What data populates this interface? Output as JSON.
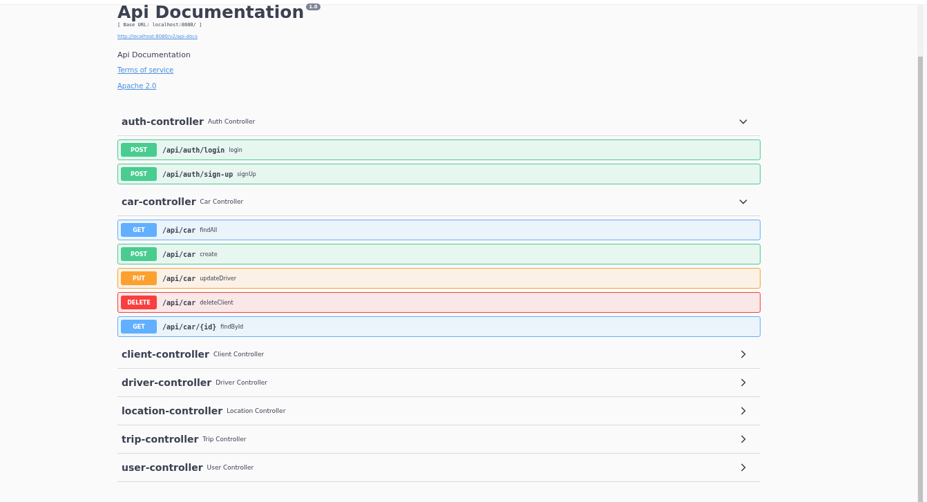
{
  "info": {
    "title": "Api Documentation",
    "version": "1.0",
    "base_url": "[ Base URL: localhost:8080/ ]",
    "docs_link": "http://localhost:8080/v2/api-docs",
    "description": "Api Documentation",
    "terms_link": "Terms of service",
    "license_link": "Apache 2.0"
  },
  "sections": [
    {
      "name": "auth-controller",
      "description": "Auth Controller",
      "expanded": true,
      "operations": [
        {
          "method": "POST",
          "path": "/api/auth/login",
          "summary": "login"
        },
        {
          "method": "POST",
          "path": "/api/auth/sign-up",
          "summary": "signUp"
        }
      ]
    },
    {
      "name": "car-controller",
      "description": "Car Controller",
      "expanded": true,
      "operations": [
        {
          "method": "GET",
          "path": "/api/car",
          "summary": "findAll"
        },
        {
          "method": "POST",
          "path": "/api/car",
          "summary": "create"
        },
        {
          "method": "PUT",
          "path": "/api/car",
          "summary": "updateDriver"
        },
        {
          "method": "DELETE",
          "path": "/api/car",
          "summary": "deleteClient"
        },
        {
          "method": "GET",
          "path": "/api/car/{id}",
          "summary": "findById"
        }
      ]
    },
    {
      "name": "client-controller",
      "description": "Client Controller",
      "expanded": false
    },
    {
      "name": "driver-controller",
      "description": "Driver Controller",
      "expanded": false
    },
    {
      "name": "location-controller",
      "description": "Location Controller",
      "expanded": false
    },
    {
      "name": "trip-controller",
      "description": "Trip Controller",
      "expanded": false
    },
    {
      "name": "user-controller",
      "description": "User Controller",
      "expanded": false
    }
  ]
}
